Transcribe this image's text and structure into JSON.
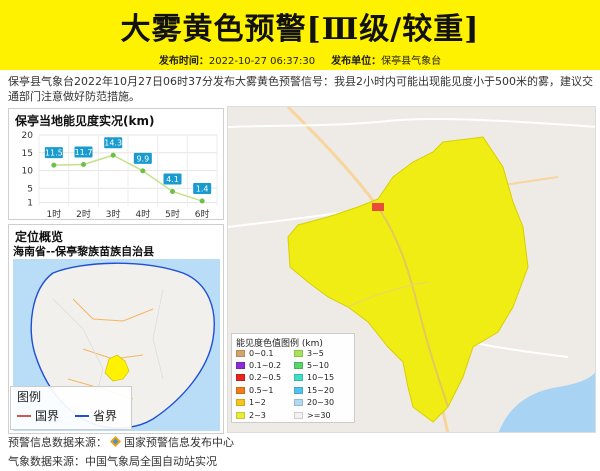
{
  "header": {
    "title": "大雾黄色预警[Ⅲ级/较重]",
    "time_label": "发布时间：",
    "time_value": "2022-10-27 06:37:30",
    "unit_label": "发布单位：",
    "unit_value": "保亭县气象台",
    "bg_color": "#fef200"
  },
  "description": "保亭县气象台2022年10月27日06时37分发布大雾黄色预警信号：我县2小时内可能出现能见度小于500米的雾，建议交通部门注意做好防范措施。",
  "visibility_panel": {
    "title": "保亭当地能见度实况(km)"
  },
  "chart_data": {
    "type": "line",
    "title": "保亭当地能见度实况(km)",
    "categories": [
      "1时",
      "2时",
      "3时",
      "4时",
      "5时",
      "6时"
    ],
    "values": [
      11.5,
      11.7,
      14.3,
      9.9,
      4.1,
      1.4
    ],
    "yticks": [
      20,
      15,
      10,
      5,
      1
    ],
    "ylim": [
      0,
      20
    ],
    "grid": true,
    "line_color": "#c6e08a",
    "label_bg": "#1a9bd0"
  },
  "location_panel": {
    "title": "定位概览",
    "region": "海南省--保亭黎族苗族自治县",
    "legend_title": "图例",
    "legend_items": [
      {
        "label": "国界",
        "color": "#d9534f"
      },
      {
        "label": "省界",
        "color": "#1f4fd6"
      }
    ]
  },
  "map_legend": {
    "title": "能见度色值图例 (km)",
    "items": [
      {
        "label": "0~0.1",
        "color": "#d3a36b"
      },
      {
        "label": "3~5",
        "color": "#a4e35a"
      },
      {
        "label": "0.1~0.2",
        "color": "#8c2bd8"
      },
      {
        "label": "5~10",
        "color": "#58d46a"
      },
      {
        "label": "0.2~0.5",
        "color": "#e8251e"
      },
      {
        "label": "10~15",
        "color": "#3fdcc8"
      },
      {
        "label": "0.5~1",
        "color": "#f07c1b"
      },
      {
        "label": "15~20",
        "color": "#4fc3ee"
      },
      {
        "label": "1~2",
        "color": "#f6c51b"
      },
      {
        "label": "20~30",
        "color": "#b0daf2"
      },
      {
        "label": "2~3",
        "color": "#eaec3a"
      },
      {
        "label": ">=30",
        "color": "#f2f2f2"
      }
    ]
  },
  "footer": {
    "warning_source_label": "预警信息数据来源：",
    "warning_source_value": "国家预警信息发布中心",
    "weather_source_label": "气象数据来源：",
    "weather_source_value": "中国气象局全国自动站实况"
  }
}
